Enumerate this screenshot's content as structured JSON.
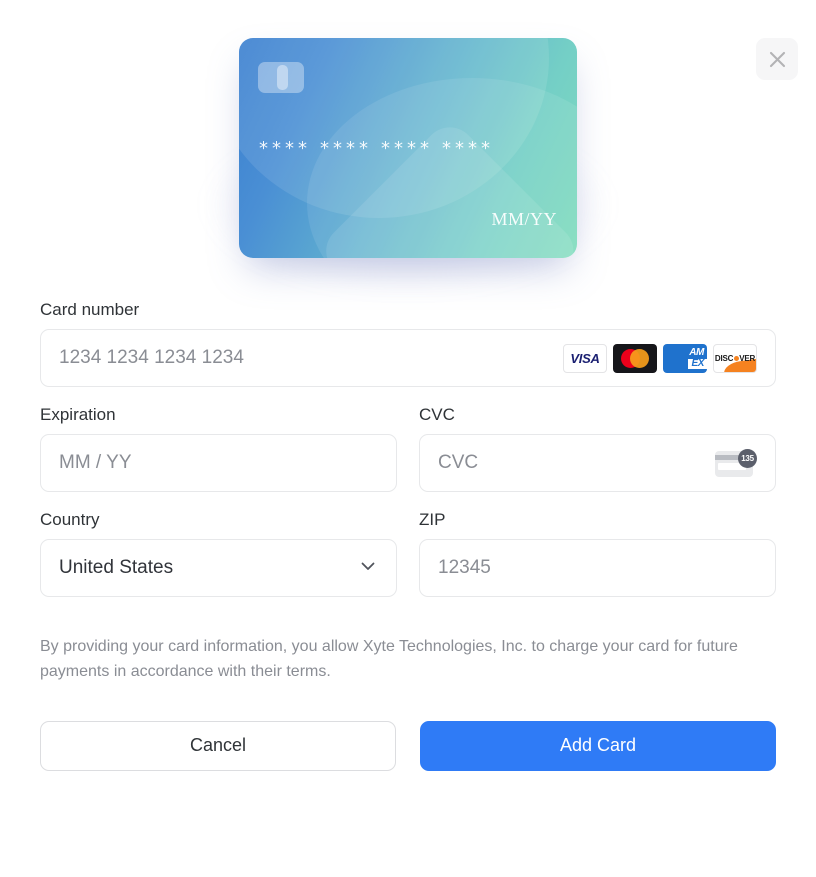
{
  "dialog": {
    "close_icon": "close-icon"
  },
  "card_preview": {
    "chip_icon": "card-chip-icon",
    "number_groups": [
      "****",
      "****",
      "****",
      "****"
    ],
    "expiry_text": "MM/YY",
    "gradient_from": "#3a7fd0",
    "gradient_to": "#80dcbd"
  },
  "form": {
    "card_number": {
      "label": "Card number",
      "placeholder": "1234 1234 1234 1234",
      "value": "",
      "brands": [
        {
          "name": "visa",
          "label": "VISA"
        },
        {
          "name": "mastercard",
          "label": ""
        },
        {
          "name": "amex",
          "label_line1": "AM",
          "label_line2": "EX"
        },
        {
          "name": "discover",
          "label_start": "DISC",
          "label_end": "VER"
        }
      ]
    },
    "expiration": {
      "label": "Expiration",
      "placeholder": "MM / YY",
      "value": ""
    },
    "cvc": {
      "label": "CVC",
      "placeholder": "CVC",
      "value": "",
      "icon_badge_text": "135"
    },
    "country": {
      "label": "Country",
      "value": "United States",
      "chevron_icon": "chevron-down-icon"
    },
    "zip": {
      "label": "ZIP",
      "placeholder": "12345",
      "value": ""
    }
  },
  "disclaimer": {
    "text": "By providing your card information, you allow Xyte Technologies, Inc. to charge your card for future payments in accordance with their terms."
  },
  "actions": {
    "cancel_label": "Cancel",
    "submit_label": "Add Card",
    "primary_color": "#2f7bf6"
  }
}
